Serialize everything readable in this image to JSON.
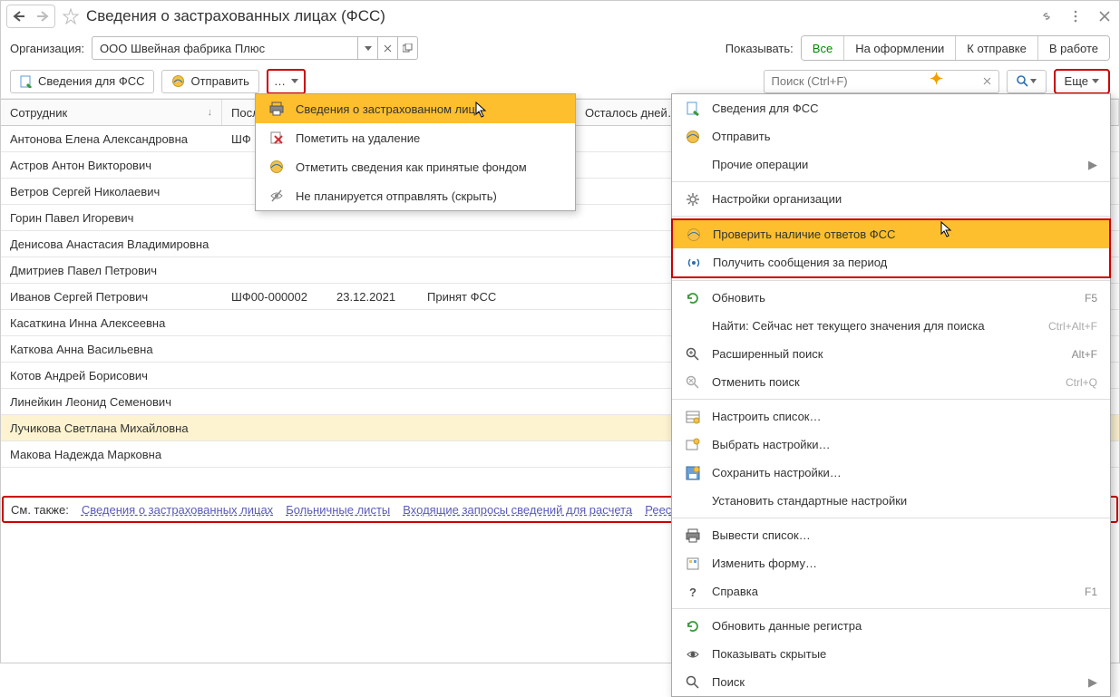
{
  "title": "Сведения о застрахованных лицах (ФСС)",
  "nav": {
    "back": "←",
    "forward": "→"
  },
  "titlebar_icons": {
    "link": "link-icon",
    "menu": "kebab-icon",
    "close": "close-icon"
  },
  "org_row": {
    "label": "Организация:",
    "value": "ООО Швейная фабрика Плюс",
    "show_label": "Показывать:",
    "filters": [
      "Все",
      "На оформлении",
      "К отправке",
      "В работе"
    ]
  },
  "toolbar": {
    "fss_btn": "Сведения для ФСС",
    "send_btn": "Отправить",
    "dots": "…",
    "search_placeholder": "Поиск (Ctrl+F)",
    "more_btn": "Еще"
  },
  "columns": {
    "employee": "Сотрудник",
    "posl": "Посл…",
    "date": "",
    "status": "",
    "days": "Осталось дней…"
  },
  "rows": [
    {
      "employee": "Антонова Елена Александровна",
      "posl": "ШФ",
      "date": "",
      "status": "",
      "sel": false
    },
    {
      "employee": "Астров Антон Викторович",
      "posl": "",
      "date": "",
      "status": "",
      "sel": false
    },
    {
      "employee": "Ветров Сергей Николаевич",
      "posl": "",
      "date": "",
      "status": "",
      "sel": false
    },
    {
      "employee": "Горин Павел Игоревич",
      "posl": "",
      "date": "",
      "status": "",
      "sel": false
    },
    {
      "employee": "Денисова Анастасия Владимировна",
      "posl": "",
      "date": "",
      "status": "",
      "sel": false
    },
    {
      "employee": "Дмитриев Павел Петрович",
      "posl": "",
      "date": "",
      "status": "",
      "sel": false
    },
    {
      "employee": "Иванов Сергей Петрович",
      "posl": "ШФ00-000002",
      "date": "23.12.2021",
      "status": "Принят ФСС",
      "sel": false
    },
    {
      "employee": "Касаткина Инна Алексеевна",
      "posl": "",
      "date": "",
      "status": "",
      "sel": false
    },
    {
      "employee": "Каткова Анна Васильевна",
      "posl": "",
      "date": "",
      "status": "",
      "sel": false
    },
    {
      "employee": "Котов Андрей Борисович",
      "posl": "",
      "date": "",
      "status": "",
      "sel": false
    },
    {
      "employee": "Линейкин Леонид Семенович",
      "posl": "",
      "date": "",
      "status": "",
      "sel": false
    },
    {
      "employee": "Лучикова Светлана Михайловна",
      "posl": "",
      "date": "",
      "status": "",
      "sel": true
    },
    {
      "employee": "Макова Надежда Марковна",
      "posl": "",
      "date": "",
      "status": "",
      "sel": false
    }
  ],
  "footer": {
    "label": "См. также:",
    "links": [
      "Сведения о застрахованных лицах",
      "Больничные листы",
      "Входящие запросы сведений для расчета",
      "Реестр…"
    ]
  },
  "dd_small": {
    "items": [
      {
        "icon": "print-icon",
        "label": "Сведения о застрахованном лице",
        "hl": true
      },
      {
        "icon": "delete-mark-icon",
        "label": "Пометить на удаление",
        "hl": false
      },
      {
        "icon": "globe-icon",
        "label": "Отметить сведения как принятые фондом",
        "hl": false
      },
      {
        "icon": "eye-slash-icon",
        "label": "Не планируется отправлять (скрыть)",
        "hl": false
      }
    ]
  },
  "dd_large": {
    "groups": [
      {
        "type": "item",
        "icon": "fss-doc-icon",
        "label": "Сведения для ФСС"
      },
      {
        "type": "item",
        "icon": "globe-icon",
        "label": "Отправить"
      },
      {
        "type": "item",
        "icon": "",
        "label": "Прочие операции",
        "chev": true
      },
      {
        "type": "sep"
      },
      {
        "type": "item",
        "icon": "gear-icon",
        "label": "Настройки организации"
      },
      {
        "type": "sep"
      },
      {
        "type": "redstart"
      },
      {
        "type": "item",
        "icon": "globe-icon",
        "label": "Проверить наличие ответов ФСС",
        "hl": true
      },
      {
        "type": "item",
        "icon": "antenna-icon",
        "label": "Получить сообщения за период"
      },
      {
        "type": "redend"
      },
      {
        "type": "sep"
      },
      {
        "type": "item",
        "icon": "refresh-icon",
        "label": "Обновить",
        "sc": "F5"
      },
      {
        "type": "item",
        "icon": "",
        "label": "Найти: Сейчас нет текущего значения для поиска",
        "sc": "Ctrl+Alt+F",
        "dis": true
      },
      {
        "type": "item",
        "icon": "searchplus-icon",
        "label": "Расширенный поиск",
        "sc": "Alt+F"
      },
      {
        "type": "item",
        "icon": "searchcancel-icon",
        "label": "Отменить поиск",
        "sc": "Ctrl+Q",
        "dis": true
      },
      {
        "type": "sep"
      },
      {
        "type": "item",
        "icon": "list-conf-icon",
        "label": "Настроить список…"
      },
      {
        "type": "item",
        "icon": "pick-conf-icon",
        "label": "Выбрать настройки…"
      },
      {
        "type": "item",
        "icon": "save-conf-icon",
        "label": "Сохранить настройки…"
      },
      {
        "type": "item",
        "icon": "",
        "label": "Установить стандартные настройки"
      },
      {
        "type": "sep"
      },
      {
        "type": "item",
        "icon": "print-icon",
        "label": "Вывести список…"
      },
      {
        "type": "item",
        "icon": "form-icon",
        "label": "Изменить форму…"
      },
      {
        "type": "item",
        "icon": "help-icon",
        "label": "Справка",
        "sc": "F1"
      },
      {
        "type": "sep"
      },
      {
        "type": "item",
        "icon": "refresh2-icon",
        "label": "Обновить данные регистра"
      },
      {
        "type": "item",
        "icon": "eye-icon",
        "label": "Показывать скрытые"
      },
      {
        "type": "item",
        "icon": "search-icon",
        "label": "Поиск",
        "chev": true
      }
    ]
  },
  "colors": {
    "highlight": "#fdbf2d",
    "red": "#c00",
    "selected_row": "#fdf3d1"
  }
}
